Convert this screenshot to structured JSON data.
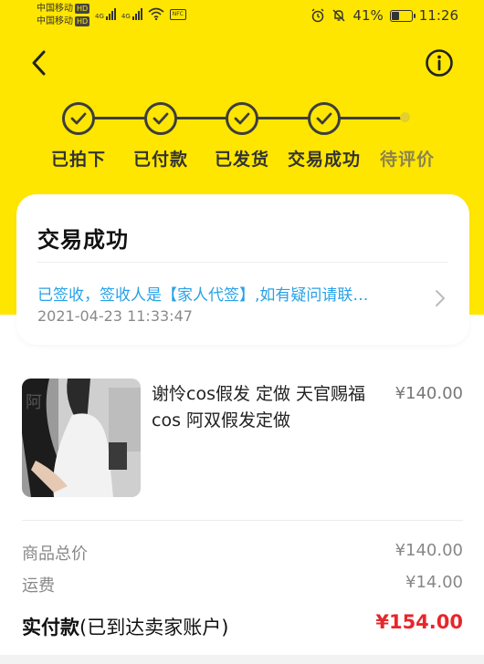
{
  "status_bar": {
    "carrier_1": "中国移动",
    "carrier_2": "中国移动",
    "hd": "HD",
    "net_1": "4G",
    "net_2": "4G",
    "nfc": "NFC",
    "battery": "41%",
    "battery_level": 0.41,
    "time": "11:26"
  },
  "steps": [
    {
      "label": "已拍下",
      "done": true
    },
    {
      "label": "已付款",
      "done": true
    },
    {
      "label": "已发货",
      "done": true
    },
    {
      "label": "交易成功",
      "done": true
    },
    {
      "label": "待评价",
      "done": false
    }
  ],
  "status_card": {
    "title": "交易成功",
    "message": "已签收，签收人是【家人代签】,如有疑问请联…",
    "time": "2021-04-23 11:33:47"
  },
  "product": {
    "title": "谢怜cos假发 定做 天官赐福cos 阿双假发定做",
    "price": "¥140.00"
  },
  "summary": {
    "total_label": "商品总价",
    "total_value": "¥140.00",
    "shipping_label": "运费",
    "shipping_value": "¥14.00",
    "paid_label": "实付款",
    "paid_note": "(已到达卖家账户)",
    "paid_value": "¥154.00"
  },
  "colors": {
    "accent_yellow": "#ffe600",
    "link_blue": "#27a1e8",
    "price_red": "#e8262a"
  }
}
